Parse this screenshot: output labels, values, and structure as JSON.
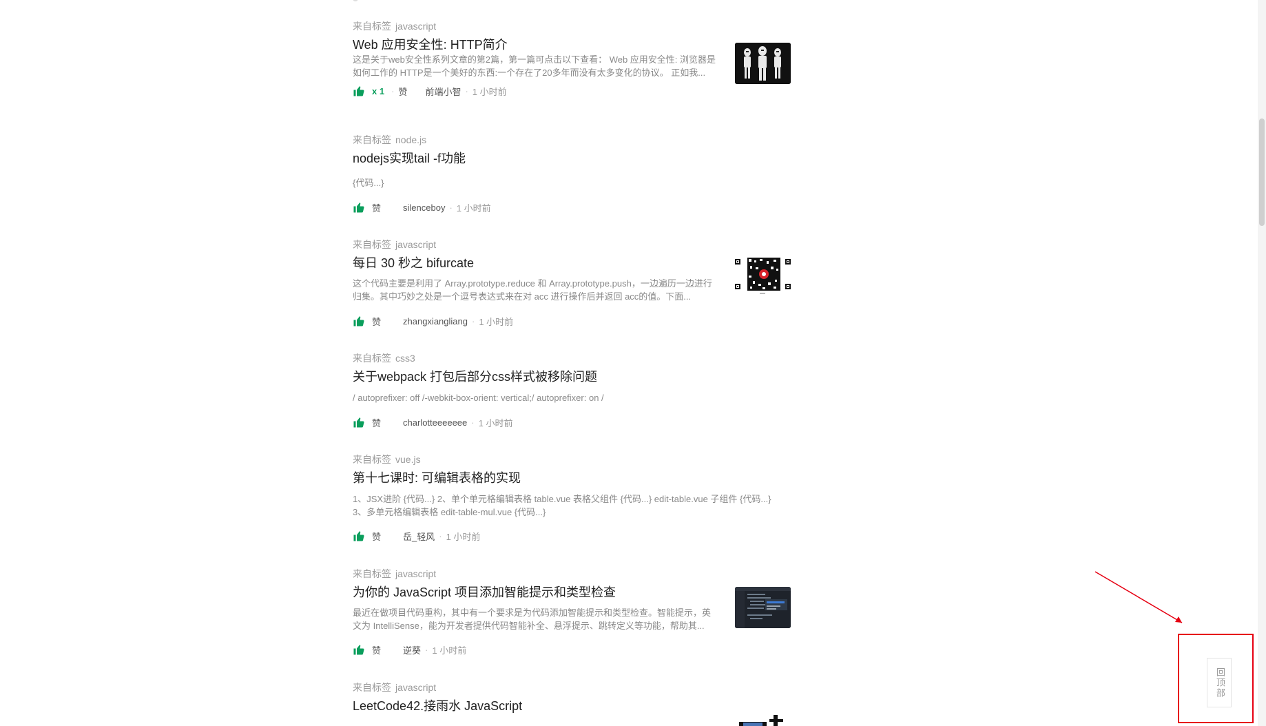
{
  "articles": [
    {
      "tag_prefix": "来自标签",
      "tag": "javascript",
      "title": "Web 应用安全性: HTTP简介",
      "excerpt": "这是关于web安全性系列文章的第2篇，第一篇可点击以下查看： Web 应用安全性: 浏览器是如何工作的 HTTP是一个美好的东西:一个存在了20多年而没有太多变化的协议。 正如我...",
      "like_count": "x 1",
      "like_label": "赞",
      "author": "前端小智",
      "time": "1 小时前",
      "thumb": "stormtroopers-image"
    },
    {
      "tag_prefix": "来自标签",
      "tag": "node.js",
      "title": "nodejs实现tail -f功能",
      "excerpt": "{代码...}",
      "like_label": "赞",
      "author": "silenceboy",
      "time": "1 小时前"
    },
    {
      "tag_prefix": "来自标签",
      "tag": "javascript",
      "title": "每日 30 秒之 bifurcate",
      "excerpt": "这个代码主要是利用了 Array.prototype.reduce 和 Array.prototype.push，一边遍历一边进行归集。其中巧妙之处是一个逗号表达式来在对 acc 进行操作后并返回 acc的值。下面...",
      "like_label": "赞",
      "author": "zhangxiangliang",
      "time": "1 小时前",
      "thumb": "qr-code-image"
    },
    {
      "tag_prefix": "来自标签",
      "tag": "css3",
      "title": "关于webpack 打包后部分css样式被移除问题",
      "excerpt": "/ autoprefixer: off /-webkit-box-orient: vertical;/ autoprefixer: on /",
      "like_label": "赞",
      "author": "charlotteeeeeee",
      "time": "1 小时前"
    },
    {
      "tag_prefix": "来自标签",
      "tag": "vue.js",
      "title": "第十七课时: 可编辑表格的实现",
      "excerpt": "1、JSX进阶 {代码...} 2、单个单元格编辑表格 table.vue 表格父组件 {代码...} edit-table.vue 子组件 {代码...} 3、多单元格编辑表格 edit-table-mul.vue {代码...}",
      "like_label": "赞",
      "author": "岳_轻风",
      "time": "1 小时前"
    },
    {
      "tag_prefix": "来自标签",
      "tag": "javascript",
      "title": "为你的 JavaScript 项目添加智能提示和类型检查",
      "excerpt": "最近在做项目代码重构，其中有一个要求是为代码添加智能提示和类型检查。智能提示，英文为 IntelliSense，能为开发者提供代码智能补全、悬浮提示、跳转定义等功能，帮助其...",
      "like_label": "赞",
      "author": "逆葵",
      "time": "1 小时前",
      "thumb": "code-editor-image"
    },
    {
      "tag_prefix": "来自标签",
      "tag": "javascript",
      "title": "LeetCode42.接雨水 JavaScript",
      "excerpt": "",
      "thumb": "chart-image"
    }
  ],
  "back_to_top": {
    "label": "回顶部"
  },
  "colors": {
    "accent": "#0a9e5c",
    "annotation": "#e60012"
  },
  "icons": {
    "like": "thumbs-up-icon"
  }
}
